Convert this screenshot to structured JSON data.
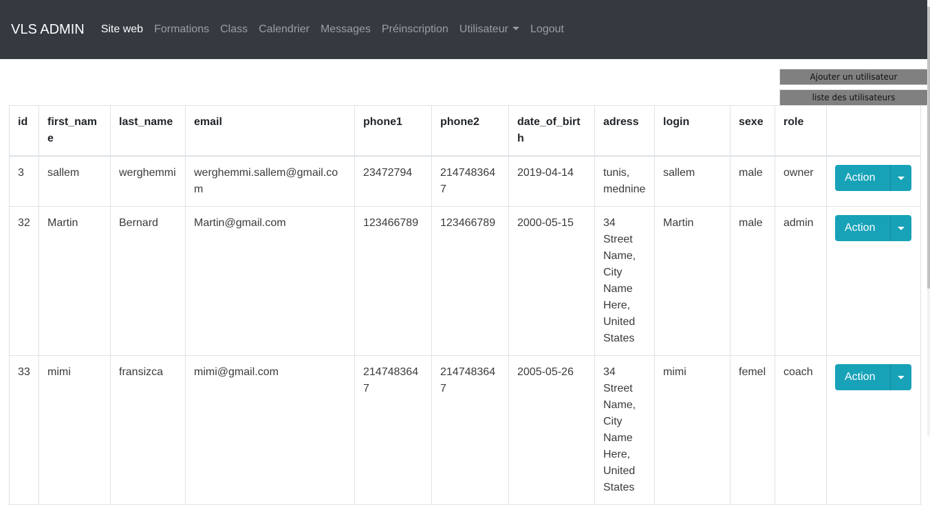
{
  "navbar": {
    "brand": "VLS ADMIN",
    "items": [
      {
        "label": "Site web",
        "active": true
      },
      {
        "label": "Formations"
      },
      {
        "label": "Class"
      },
      {
        "label": "Calendrier"
      },
      {
        "label": "Messages"
      },
      {
        "label": "Préinscription"
      },
      {
        "label": "Utilisateur",
        "dropdown": true
      },
      {
        "label": "Logout"
      }
    ]
  },
  "buttons": {
    "add_user": "Ajouter un utilisateur",
    "list_users": "liste des utilisateurs"
  },
  "table": {
    "headers": [
      "id",
      "first_name",
      "last_name",
      "email",
      "phone1",
      "phone2",
      "date_of_birth",
      "adress",
      "login",
      "sexe",
      "role",
      ""
    ],
    "rows": [
      {
        "id": "3",
        "first_name": "sallem",
        "last_name": "werghemmi",
        "email": "werghemmi.sallem@gmail.com",
        "phone1": "23472794",
        "phone2": "2147483647",
        "date_of_birth": "2019-04-14",
        "adress": "tunis, mednine",
        "login": "sallem",
        "sexe": "male",
        "role": "owner",
        "action": "Action"
      },
      {
        "id": "32",
        "first_name": "Martin",
        "last_name": "Bernard",
        "email": "Martin@gmail.com",
        "phone1": "123466789",
        "phone2": "123466789",
        "date_of_birth": "2000-05-15",
        "adress": "34 Street Name, City Name Here, United States",
        "login": "Martin",
        "sexe": "male",
        "role": "admin",
        "action": "Action"
      },
      {
        "id": "33",
        "first_name": "mimi",
        "last_name": "fransizca",
        "email": "mimi@gmail.com",
        "phone1": "2147483647",
        "phone2": "2147483647",
        "date_of_birth": "2005-05-26",
        "adress": "34 Street Name, City Name Here, United States",
        "login": "mimi",
        "sexe": "femel",
        "role": "coach",
        "action": "Action"
      }
    ]
  },
  "colors": {
    "navbar_bg": "#343a40",
    "action_button": "#17a2b8",
    "side_button": "#808080"
  }
}
